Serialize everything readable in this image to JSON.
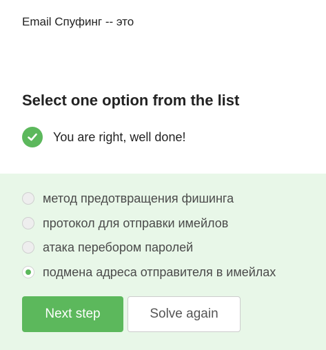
{
  "question": {
    "text": "Email Спуфинг -- это"
  },
  "instruction": {
    "text": "Select one option from the list"
  },
  "feedback": {
    "icon": "checkmark-circle-icon",
    "text": "You are right, well done!",
    "color": "#5cb85c"
  },
  "options": [
    {
      "label": "метод предотвращения фишинга",
      "selected": false
    },
    {
      "label": "протокол для отправки имейлов",
      "selected": false
    },
    {
      "label": "атака перебором паролей",
      "selected": false
    },
    {
      "label": "подмена адреса отправителя в имейлах",
      "selected": true
    }
  ],
  "buttons": {
    "next_label": "Next step",
    "solve_again_label": "Solve again"
  },
  "colors": {
    "accent": "#5cb85c",
    "options_background": "#e8f7e8"
  }
}
